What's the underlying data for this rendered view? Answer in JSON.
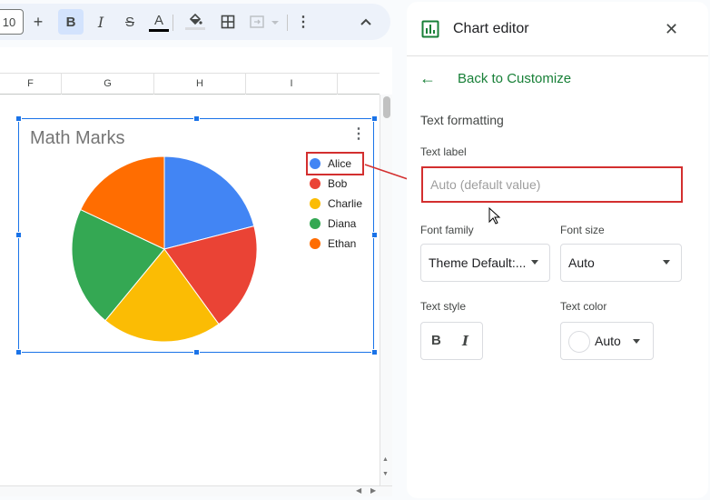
{
  "toolbar": {
    "font_size": "10",
    "increase_label": "+",
    "bold_label": "B",
    "italic_label": "I",
    "strike_label": "S",
    "text_color_label": "A"
  },
  "sheet": {
    "columns": [
      "F",
      "G",
      "H",
      "I"
    ]
  },
  "chart": {
    "title": "Math Marks"
  },
  "chart_data": {
    "type": "pie",
    "title": "Math Marks",
    "legend_position": "right",
    "categories": [
      "Alice",
      "Bob",
      "Charlie",
      "Diana",
      "Ethan"
    ],
    "values": [
      21,
      19,
      21,
      21,
      18
    ],
    "colors": [
      "#4285f4",
      "#ea4335",
      "#fbbc04",
      "#34a853",
      "#ff6d01"
    ]
  },
  "panel": {
    "title": "Chart editor",
    "back_label": "Back to Customize",
    "section_title": "Text formatting",
    "text_label_label": "Text label",
    "text_label_placeholder": "Auto (default value)",
    "font_family_label": "Font family",
    "font_family_value": "Theme Default:...",
    "font_size_label": "Font size",
    "font_size_value": "Auto",
    "text_style_label": "Text style",
    "bold_label": "B",
    "italic_label": "I",
    "text_color_label": "Text color",
    "text_color_value": "Auto"
  },
  "colors": {
    "accent": "#1a73e8",
    "green": "#188038",
    "highlight": "#d32f2f"
  }
}
